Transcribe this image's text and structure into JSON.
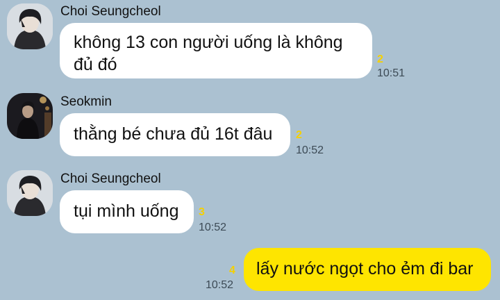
{
  "colors": {
    "background": "#abc1d1",
    "incoming_bubble": "#ffffff",
    "outgoing_bubble": "#fee500",
    "unread_count": "#f5d000"
  },
  "messages": [
    {
      "sender": "Choi Seungcheol",
      "avatar": "avatar-choi-seungcheol",
      "text_lines": [
        "không 13 con người uống là không",
        "đủ đó"
      ],
      "unread": "2",
      "time": "10:51"
    },
    {
      "sender": "Seokmin",
      "avatar": "avatar-seokmin",
      "text_lines": [
        "thằng bé chưa đủ 16t đâu"
      ],
      "unread": "2",
      "time": "10:52"
    },
    {
      "sender": "Choi Seungcheol",
      "avatar": "avatar-choi-seungcheol",
      "text_lines": [
        "tụi mình uống"
      ],
      "unread": "3",
      "time": "10:52"
    },
    {
      "sender": "",
      "outgoing": true,
      "text_lines": [
        "lấy nước ngọt cho ẻm đi bar"
      ],
      "unread": "4",
      "time": "10:52"
    }
  ]
}
